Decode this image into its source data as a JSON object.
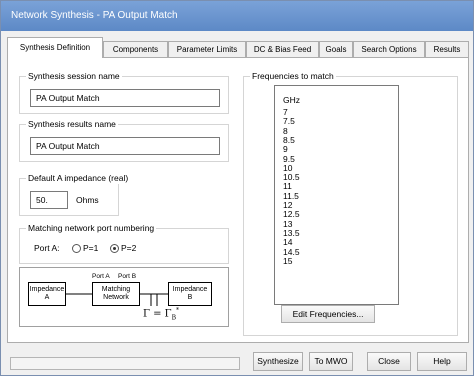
{
  "window": {
    "title": "Network Synthesis - PA Output Match"
  },
  "tabs": [
    "Synthesis Definition",
    "Components",
    "Parameter Limits",
    "DC & Bias Feed",
    "Goals",
    "Search Options",
    "Results"
  ],
  "session": {
    "label": "Synthesis session name",
    "value": "PA Output Match"
  },
  "results": {
    "label": "Synthesis results name",
    "value": "PA Output Match"
  },
  "impedance": {
    "label": "Default A impedance (real)",
    "value": "50.",
    "unit": "Ohms"
  },
  "port_numbering": {
    "label": "Matching network port numbering",
    "port_label": "Port A:",
    "option1": "P=1",
    "option2": "P=2"
  },
  "diagram": {
    "box_left": [
      "Impedance",
      "A"
    ],
    "box_mid": [
      "Matching",
      "Network"
    ],
    "box_right": [
      "Impedance",
      "B"
    ],
    "port_a": "Port A",
    "port_b": "Port B",
    "equation": "Γ = Γ",
    "eq_sub": "B",
    "eq_sup": "*"
  },
  "frequencies": {
    "label": "Frequencies to match",
    "unit": "GHz",
    "values": [
      "7",
      "7.5",
      "8",
      "8.5",
      "9",
      "9.5",
      "10",
      "10.5",
      "11",
      "11.5",
      "12",
      "12.5",
      "13",
      "13.5",
      "14",
      "14.5",
      "15"
    ],
    "edit_button": "Edit Frequencies..."
  },
  "bottom_buttons": {
    "synthesize": "Synthesize",
    "to_mwo": "To MWO",
    "close": "Close",
    "help": "Help"
  }
}
